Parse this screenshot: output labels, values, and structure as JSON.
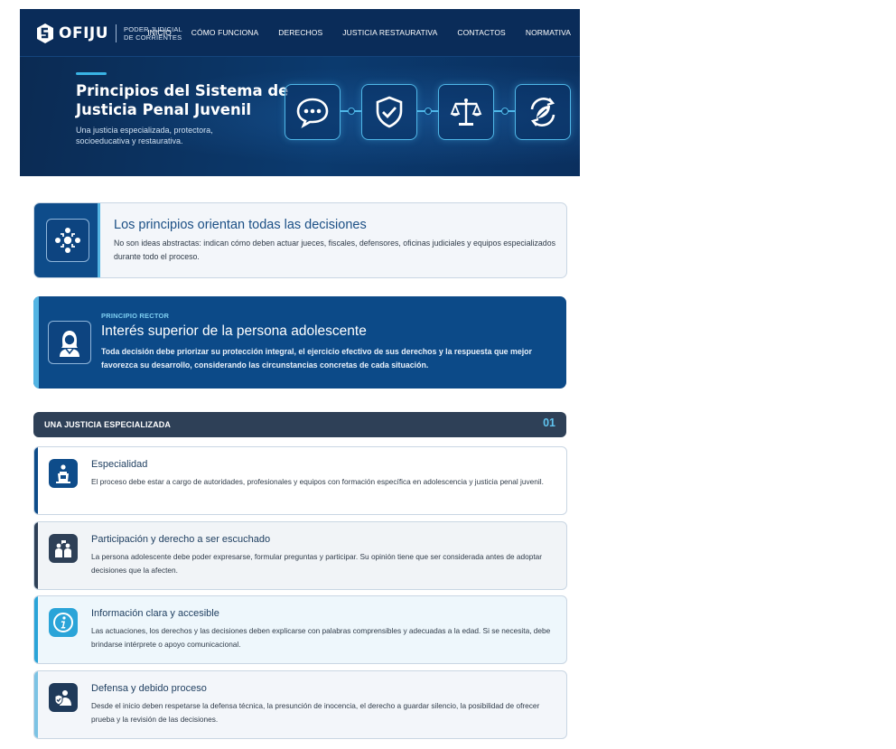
{
  "header": {
    "logo_name": "OFIJU",
    "logo_sub_line1": "PODER JUDICIAL",
    "logo_sub_line2": "DE CORRIENTES",
    "nav": [
      "INICIO",
      "CÓMO FUNCIONA",
      "DERECHOS",
      "JUSTICIA RESTAURATIVA",
      "CONTACTOS",
      "NORMATIVA"
    ]
  },
  "hero": {
    "title": "Principios del Sistema de Justicia Penal Juvenil",
    "subtitle": "Una justicia especializada, protectora, socioeducativa y restaurativa.",
    "icons": [
      "chat-bubble-icon",
      "shield-check-icon",
      "scales-icon",
      "recycle-leaf-icon"
    ]
  },
  "intro": {
    "icon": "network-people-icon",
    "title": "Los principios orientan todas las decisiones",
    "text": "No son ideas abstractas: indican cómo deben actuar jueces, fiscales, defensores, oficinas judiciales y equipos especializados durante todo el proceso."
  },
  "rector": {
    "icon": "adolescent-person-icon",
    "kicker": "PRINCIPIO RECTOR",
    "title": "Interés superior de la persona adolescente",
    "text": "Toda decisión debe priorizar su protección integral, el ejercicio efectivo de sus derechos y la respuesta que mejor favorezca su desarrollo, considerando las circunstancias concretas de cada situación."
  },
  "section": {
    "title": "UNA JUSTICIA ESPECIALIZADA",
    "number": "01"
  },
  "cards": [
    {
      "icon": "authority-podium-icon",
      "title": "Especialidad",
      "text": "El proceso debe estar a cargo de autoridades, profesionales y equipos con formación específica en adolescencia y justicia penal juvenil."
    },
    {
      "icon": "people-speaking-icon",
      "title": "Participación y derecho a ser escuchado",
      "text": "La persona adolescente debe poder expresarse, formular preguntas y participar. Su opinión tiene que ser considerada antes de adoptar decisiones que la afecten."
    },
    {
      "icon": "info-icon",
      "title": "Información clara y accesible",
      "text": "Las actuaciones, los derechos y las decisiones deben explicarse con palabras comprensibles y adecuadas a la edad. Si se necesita, debe brindarse intérprete o apoyo comunicacional."
    },
    {
      "icon": "defense-shield-person-icon",
      "title": "Defensa y debido proceso",
      "text": "Desde el inicio deben respetarse la defensa técnica, la presunción de inocencia, el derecho a guardar silencio, la posibilidad de ofrecer prueba y la revisión de las decisiones."
    }
  ],
  "colors": {
    "navy": "#0a2c59",
    "primary_blue": "#0e4c8a",
    "accent_cyan": "#53b4e3",
    "slate": "#2e4057"
  }
}
